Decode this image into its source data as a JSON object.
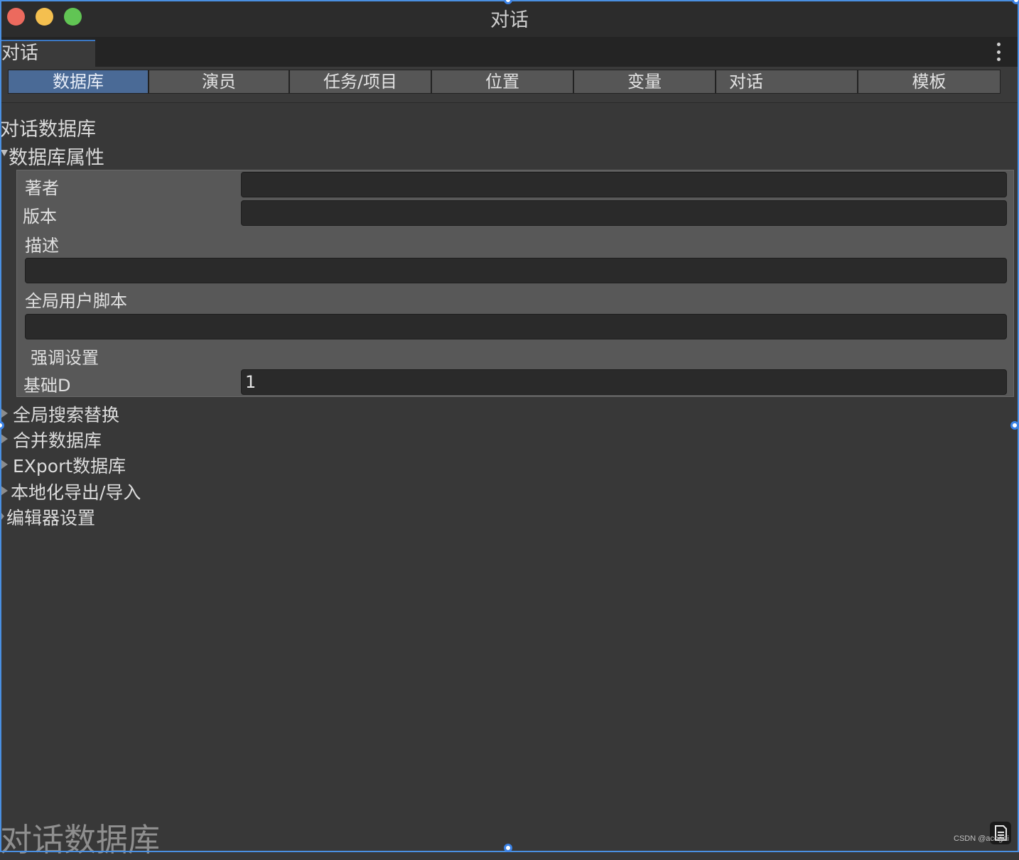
{
  "window": {
    "title": "对话",
    "tab_label": "对话"
  },
  "toolbar": {
    "tabs": [
      {
        "label": "数据库",
        "active": true
      },
      {
        "label": "演员",
        "active": false
      },
      {
        "label": "任务/项目",
        "active": false
      },
      {
        "label": "位置",
        "active": false
      },
      {
        "label": "变量",
        "active": false
      },
      {
        "label": "对话",
        "active": false
      },
      {
        "label": "模板",
        "active": false
      }
    ]
  },
  "main": {
    "heading": "对话数据库",
    "properties_section": {
      "title": "数据库属性",
      "fields": {
        "author_label": "著者",
        "author_value": "",
        "version_label": "版本",
        "version_value": "",
        "description_label": "描述",
        "description_value": "",
        "global_script_label": "全局用户脚本",
        "global_script_value": "",
        "emphasis_label": "强调设置",
        "base_id_label": "基础D",
        "base_id_value": "1"
      }
    },
    "foldouts": [
      {
        "label": "全局搜索替换"
      },
      {
        "label": "合并数据库"
      },
      {
        "label": "EXport数据库"
      },
      {
        "label": "本地化导出/导入"
      },
      {
        "label": "编辑器设置"
      }
    ]
  },
  "footer": {
    "title": "对话数据库",
    "watermark": "CSDN @acogai"
  },
  "colors": {
    "accent": "#4a6a96",
    "frame": "#4a90e2",
    "background": "#383838"
  }
}
